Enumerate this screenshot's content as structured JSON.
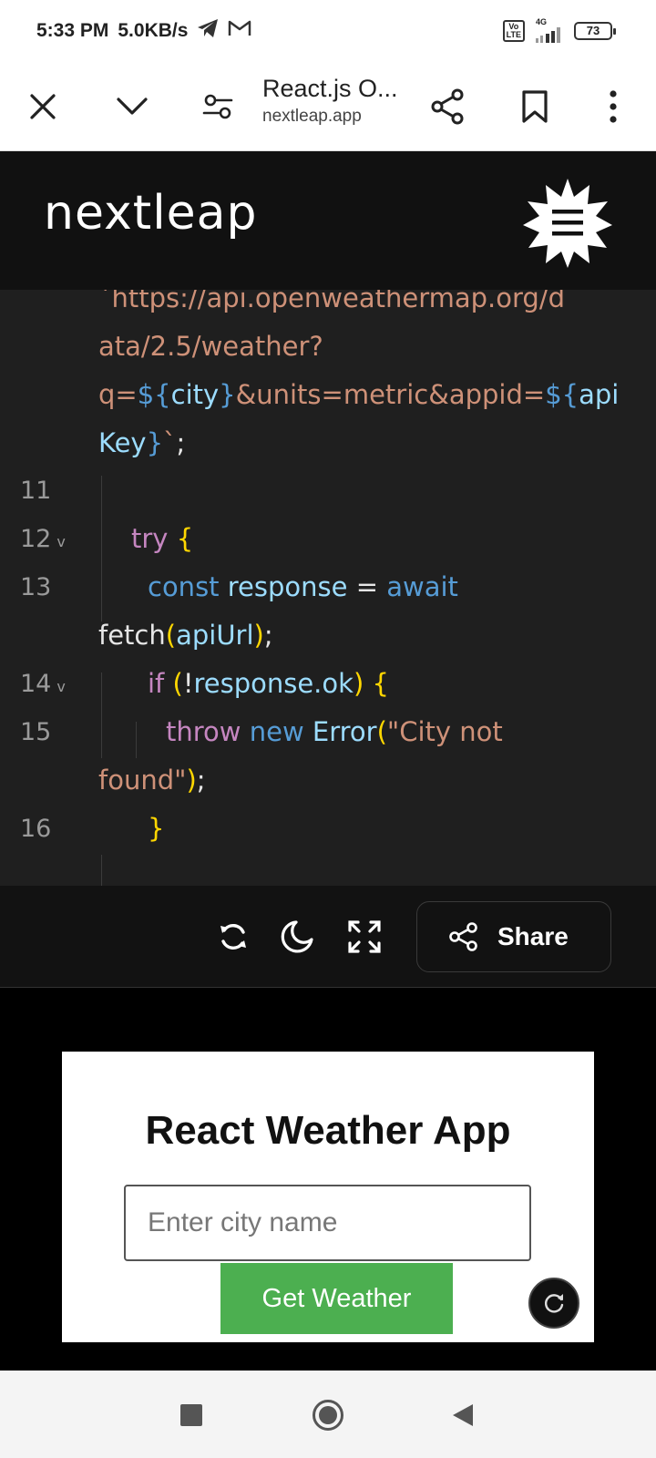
{
  "status_bar": {
    "time": "5:33 PM",
    "net_speed": "5.0KB/s",
    "network_type": "4G",
    "volte_label": "Vo\nLTE",
    "battery": "73"
  },
  "browser": {
    "page_title": "React.js O...",
    "domain": "nextleap.app"
  },
  "site": {
    "logo_text": "nextleap"
  },
  "code": {
    "url_line1": "`https://api.openweathermap.org/d",
    "url_line2": "ata/2.5/weather?",
    "url_q": "q=",
    "url_dollar1": "$",
    "url_brace_open": "{",
    "url_city": "city",
    "url_brace_close": "}",
    "url_mid": "&units=metric&appid=",
    "url_dollar2": "$",
    "url_brace_open2": "{",
    "url_api": "api",
    "url_key": "Key",
    "url_brace_close2": "}",
    "url_end": "`",
    "semicolon": ";",
    "ln11": "11",
    "ln12": "12",
    "ln13": "13",
    "ln14": "14",
    "ln15": "15",
    "ln16": "16",
    "fold_chevron": "v",
    "try_kw": "try",
    "open_brace": "{",
    "const_kw": "const",
    "response_var": "response",
    "equals": "=",
    "await_kw": "await",
    "fetch_fn": "fetch",
    "paren_open": "(",
    "apiurl_var": "apiUrl",
    "paren_close": ")",
    "if_kw": "if",
    "not_op": "!",
    "response_ok": "response.ok",
    "throw_kw": "throw",
    "new_kw": "new",
    "error_cls": "Error",
    "error_msg_1": "\"City not",
    "error_msg_2": "found\"",
    "close_brace": "}"
  },
  "editor_footer": {
    "share_label": "Share"
  },
  "preview": {
    "title": "React Weather App",
    "input_placeholder": "Enter city name",
    "button_label": "Get Weather"
  }
}
